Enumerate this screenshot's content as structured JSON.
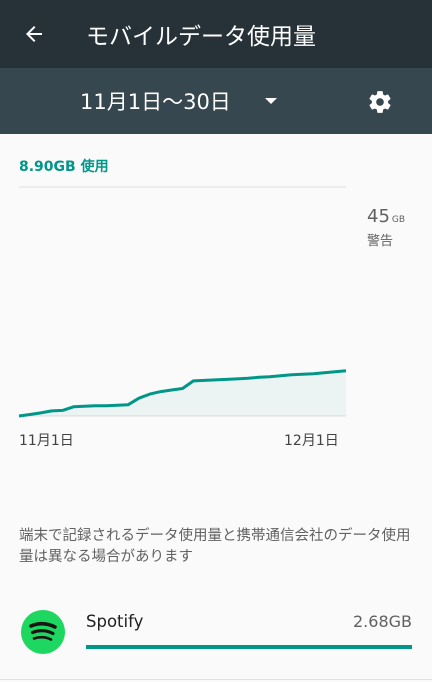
{
  "appbar": {
    "title": "モバイルデータ使用量",
    "back_icon": "arrow-back-icon"
  },
  "cycle": {
    "label": "11月1日〜30日",
    "dropdown_icon": "dropdown-triangle-icon",
    "settings_icon": "gear-icon"
  },
  "summary": {
    "total_used": "8.90GB 使用"
  },
  "warning": {
    "value": "45",
    "unit": "GB",
    "label": "警告"
  },
  "chart_data": {
    "type": "area",
    "x_start_label": "11月1日",
    "x_end_label": "12月1日",
    "x": [
      1,
      2,
      3,
      4,
      5,
      6,
      7,
      8,
      9,
      10,
      11,
      12,
      13,
      14,
      15,
      16,
      17,
      18,
      19,
      20,
      21,
      22,
      23,
      24,
      25,
      26,
      27,
      28,
      29,
      30,
      31
    ],
    "y": [
      0.0,
      0.3,
      0.6,
      1.0,
      1.1,
      1.8,
      1.9,
      2.0,
      2.0,
      2.1,
      2.2,
      3.5,
      4.3,
      4.8,
      5.1,
      5.4,
      6.9,
      7.0,
      7.1,
      7.2,
      7.3,
      7.4,
      7.6,
      7.7,
      7.9,
      8.1,
      8.2,
      8.3,
      8.5,
      8.7,
      8.9
    ],
    "y_unit": "GB",
    "ylim": [
      0,
      45
    ],
    "warning_threshold": 45,
    "grid": false,
    "color": "#009688"
  },
  "disclaimer": "端末で記録されるデータ使用量と携帯通信会社のデータ使用量は異なる場合があります",
  "apps": [
    {
      "name": "Spotify",
      "usage": "2.68GB",
      "icon": "spotify-icon",
      "usage_fraction": 1.0
    }
  ],
  "colors": {
    "appbar": "#263238",
    "cyclebar": "#37474f",
    "accent": "#009688",
    "spotify": "#1ed760"
  }
}
